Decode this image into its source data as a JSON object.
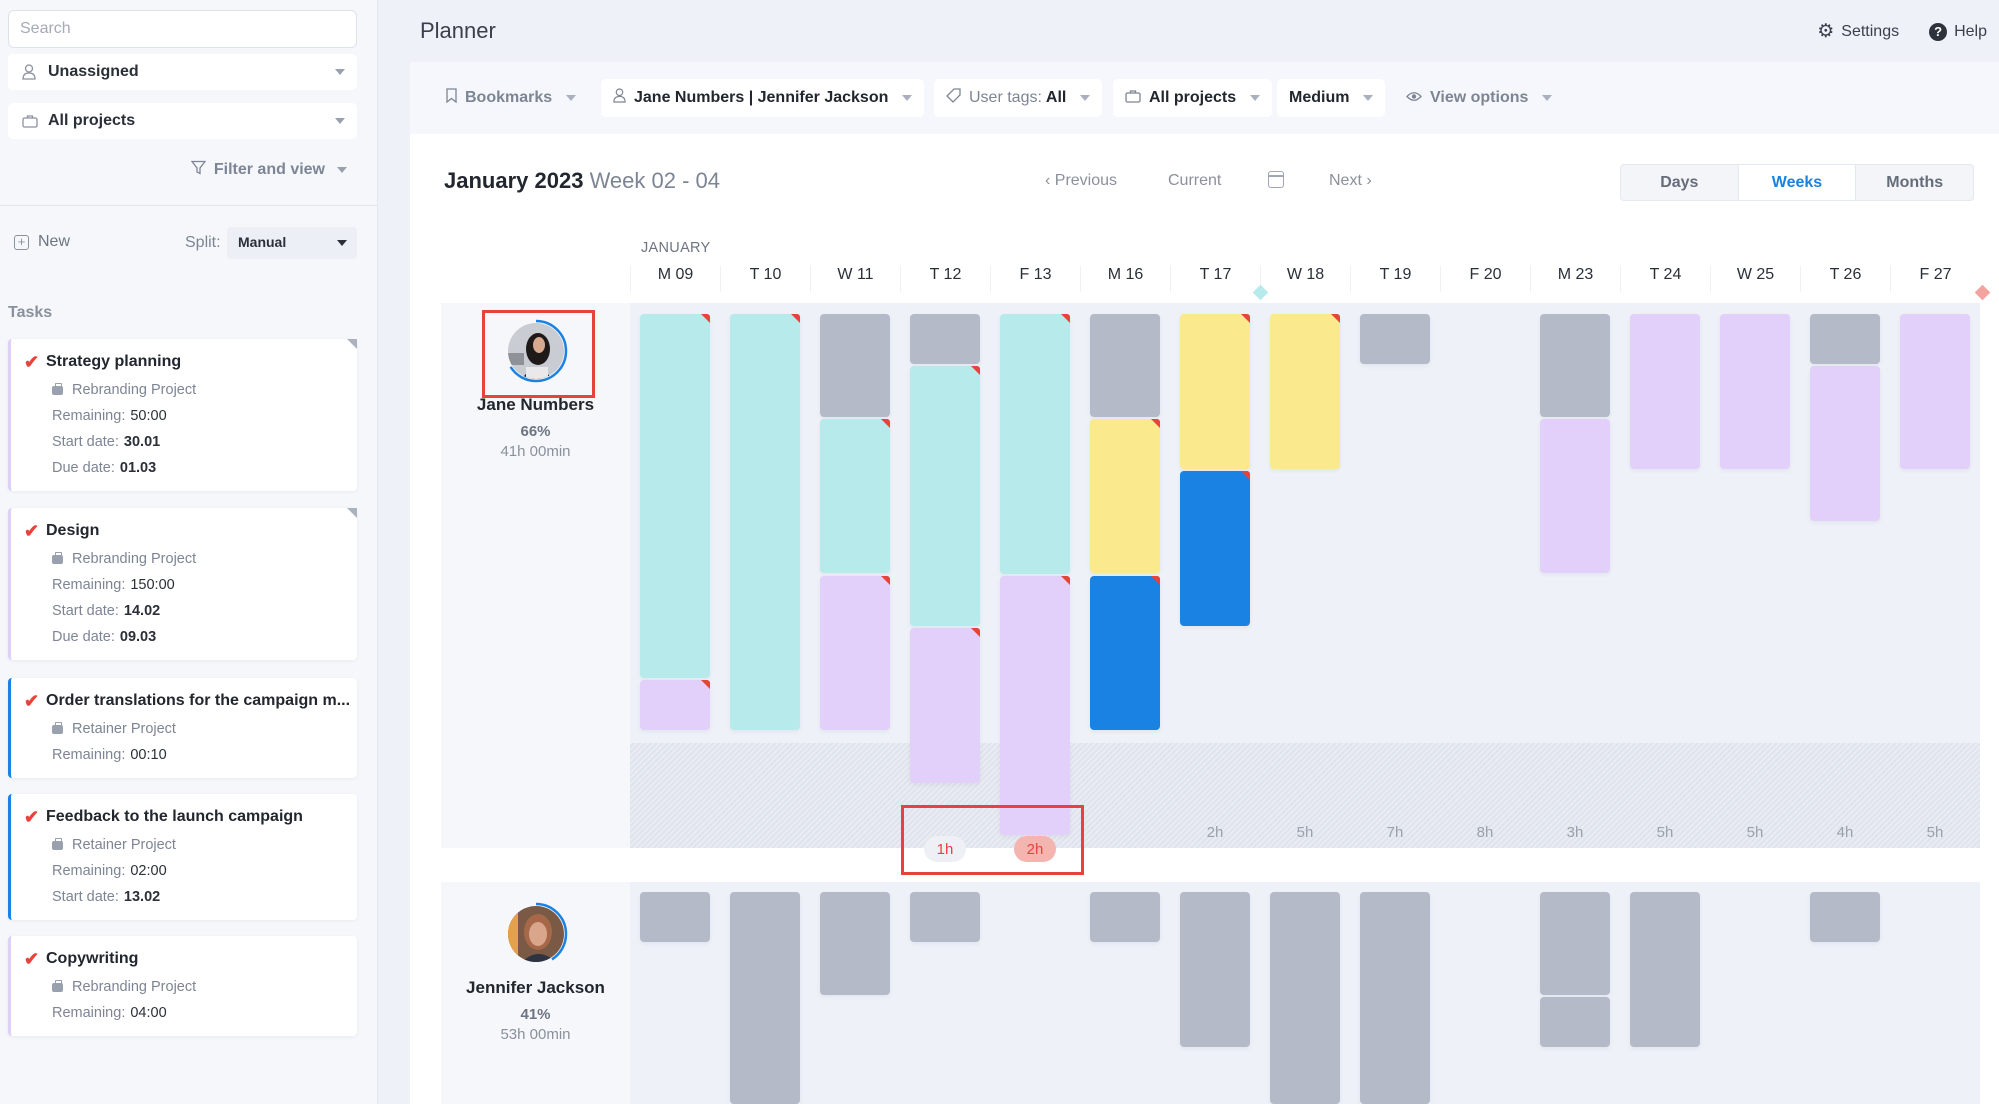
{
  "sidebar": {
    "search_placeholder": "Search",
    "assignee_filter": "Unassigned",
    "project_filter": "All projects",
    "filter_and_view": "Filter and view",
    "new_label": "New",
    "split_label": "Split:",
    "split_value": "Manual",
    "tasks_heading": "Tasks",
    "tasks": [
      {
        "title": "Strategy planning",
        "project": "Rebranding Project",
        "remaining_label": "Remaining:",
        "remaining": "50:00",
        "start_label": "Start date:",
        "start": "30.01",
        "due_label": "Due date:",
        "due": "01.03",
        "accent": "#ddd0fb"
      },
      {
        "title": "Design",
        "project": "Rebranding Project",
        "remaining_label": "Remaining:",
        "remaining": "150:00",
        "start_label": "Start date:",
        "start": "14.02",
        "due_label": "Due date:",
        "due": "09.03",
        "accent": "#ddd0fb"
      },
      {
        "title": "Order translations for the campaign m...",
        "project": "Retainer Project",
        "remaining_label": "Remaining:",
        "remaining": "00:10",
        "accent": "#1a82e2"
      },
      {
        "title": "Feedback to the launch campaign",
        "project": "Retainer Project",
        "remaining_label": "Remaining:",
        "remaining": "02:00",
        "start_label": "Start date:",
        "start": "13.02",
        "accent": "#1a82e2"
      },
      {
        "title": "Copywriting",
        "project": "Rebranding Project",
        "remaining_label": "Remaining:",
        "remaining": "04:00",
        "accent": "#ddd0fb"
      }
    ]
  },
  "header": {
    "title": "Planner",
    "settings_label": "Settings",
    "help_label": "Help"
  },
  "toolbar": {
    "bookmarks": "Bookmarks",
    "users": "Jane Numbers | Jennifer Jackson",
    "user_tags_label": "User tags:",
    "user_tags_value": "All",
    "projects": "All projects",
    "size": "Medium",
    "view_options": "View options"
  },
  "period": {
    "month_year": "January 2023",
    "weeks": "Week 02 - 04",
    "previous": "‹ Previous",
    "current": "Current",
    "next": "Next ›",
    "views": [
      "Days",
      "Weeks",
      "Months"
    ],
    "active_view": "Weeks"
  },
  "calendar": {
    "month_label": "JANUARY",
    "days": [
      "M 09",
      "T 10",
      "W 11",
      "T 12",
      "F 13",
      "M 16",
      "T 17",
      "W 18",
      "T 19",
      "F 20",
      "M 23",
      "T 24",
      "W 25",
      "T 26",
      "F 27"
    ],
    "capacity_hours": 8,
    "colors": {
      "gray": "#b4bac7",
      "teal": "#b7eaea",
      "purple": "#e2d0fb",
      "yellow": "#fbe98d",
      "blue": "#1a82e2",
      "flag": "#e8433a",
      "ring": "#1a82e2"
    },
    "people": [
      {
        "name": "Jane Numbers",
        "utilization": "66%",
        "utilization_value": 0.66,
        "hours": "41h 00min",
        "schedule": [
          [
            {
              "c": "teal",
              "h": 7,
              "flag": true
            },
            {
              "c": "purple",
              "h": 1,
              "flag": true
            }
          ],
          [
            {
              "c": "teal",
              "h": 8,
              "flag": true
            }
          ],
          [
            {
              "c": "gray",
              "h": 2
            },
            {
              "c": "teal",
              "h": 3,
              "flag": true
            },
            {
              "c": "purple",
              "h": 3,
              "flag": true
            }
          ],
          [
            {
              "c": "gray",
              "h": 1
            },
            {
              "c": "teal",
              "h": 5,
              "flag": true
            },
            {
              "c": "purple",
              "h": 3,
              "flag": true
            }
          ],
          [
            {
              "c": "teal",
              "h": 5,
              "flag": true
            },
            {
              "c": "purple",
              "h": 5,
              "flag": true
            }
          ],
          [
            {
              "c": "gray",
              "h": 2
            },
            {
              "c": "yellow",
              "h": 3,
              "flag": true
            },
            {
              "c": "blue",
              "h": 3,
              "flag": true
            }
          ],
          [
            {
              "c": "yellow",
              "h": 3,
              "flag": true
            },
            {
              "c": "blue",
              "h": 3,
              "flag": true
            }
          ],
          [
            {
              "c": "yellow",
              "h": 3,
              "flag": true
            }
          ],
          [
            {
              "c": "gray",
              "h": 1
            }
          ],
          [],
          [
            {
              "c": "gray",
              "h": 2
            },
            {
              "c": "purple",
              "h": 3
            }
          ],
          [
            {
              "c": "purple",
              "h": 3
            }
          ],
          [
            {
              "c": "purple",
              "h": 3
            }
          ],
          [
            {
              "c": "gray",
              "h": 1
            },
            {
              "c": "purple",
              "h": 3
            }
          ],
          [
            {
              "c": "purple",
              "h": 3
            }
          ]
        ],
        "day_labels": [
          "",
          "",
          "",
          "1h",
          "2h",
          "",
          "2h",
          "5h",
          "7h",
          "8h",
          "3h",
          "5h",
          "5h",
          "4h",
          "5h"
        ],
        "overbooked_days": [
          3,
          4
        ]
      },
      {
        "name": "Jennifer Jackson",
        "utilization": "41%",
        "utilization_value": 0.41,
        "hours": "53h 00min",
        "schedule": [
          [
            {
              "c": "gray",
              "h": 1
            }
          ],
          [
            {
              "c": "gray",
              "h": 5
            }
          ],
          [
            {
              "c": "gray",
              "h": 2
            }
          ],
          [
            {
              "c": "gray",
              "h": 1
            }
          ],
          [],
          [
            {
              "c": "gray",
              "h": 1
            }
          ],
          [
            {
              "c": "gray",
              "h": 3
            }
          ],
          [
            {
              "c": "gray",
              "h": 5
            }
          ],
          [
            {
              "c": "gray",
              "h": 5
            }
          ],
          [],
          [
            {
              "c": "gray",
              "h": 2
            },
            {
              "c": "gray",
              "h": 1
            }
          ],
          [
            {
              "c": "gray",
              "h": 3
            }
          ],
          [],
          [
            {
              "c": "gray",
              "h": 1
            }
          ],
          []
        ]
      }
    ]
  }
}
